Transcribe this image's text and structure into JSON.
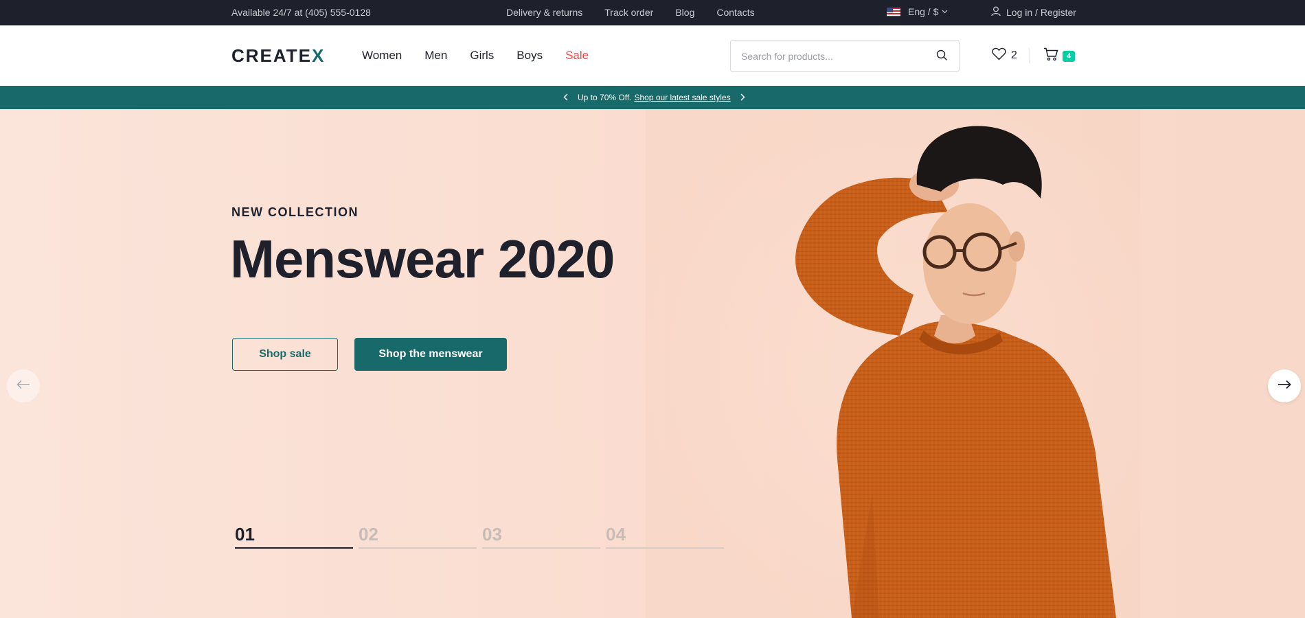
{
  "topbar": {
    "phone": "Available 24/7 at (405) 555-0128",
    "links": [
      "Delivery & returns",
      "Track order",
      "Blog",
      "Contacts"
    ],
    "language": "Eng / $",
    "login": "Log in / Register"
  },
  "header": {
    "logo_main": "CREATE",
    "logo_accent": "X",
    "nav": [
      "Women",
      "Men",
      "Girls",
      "Boys",
      "Sale"
    ],
    "search_placeholder": "Search for products...",
    "wishlist_count": "2",
    "cart_count": "4"
  },
  "promo": {
    "text": "Up to 70% Off.",
    "link": "Shop our latest sale styles"
  },
  "hero": {
    "eyebrow": "NEW COLLECTION",
    "title": "Menswear 2020",
    "btn_sale": "Shop sale",
    "btn_menswear": "Shop the menswear",
    "slides": [
      "01",
      "02",
      "03",
      "04"
    ],
    "active_slide": "01"
  },
  "colors": {
    "primary": "#17696a",
    "dark": "#1e212c",
    "sale": "#ff4242",
    "badge": "#03cea4",
    "hero_bg": "#fbe3d8",
    "sweater": "#c85f1a"
  }
}
